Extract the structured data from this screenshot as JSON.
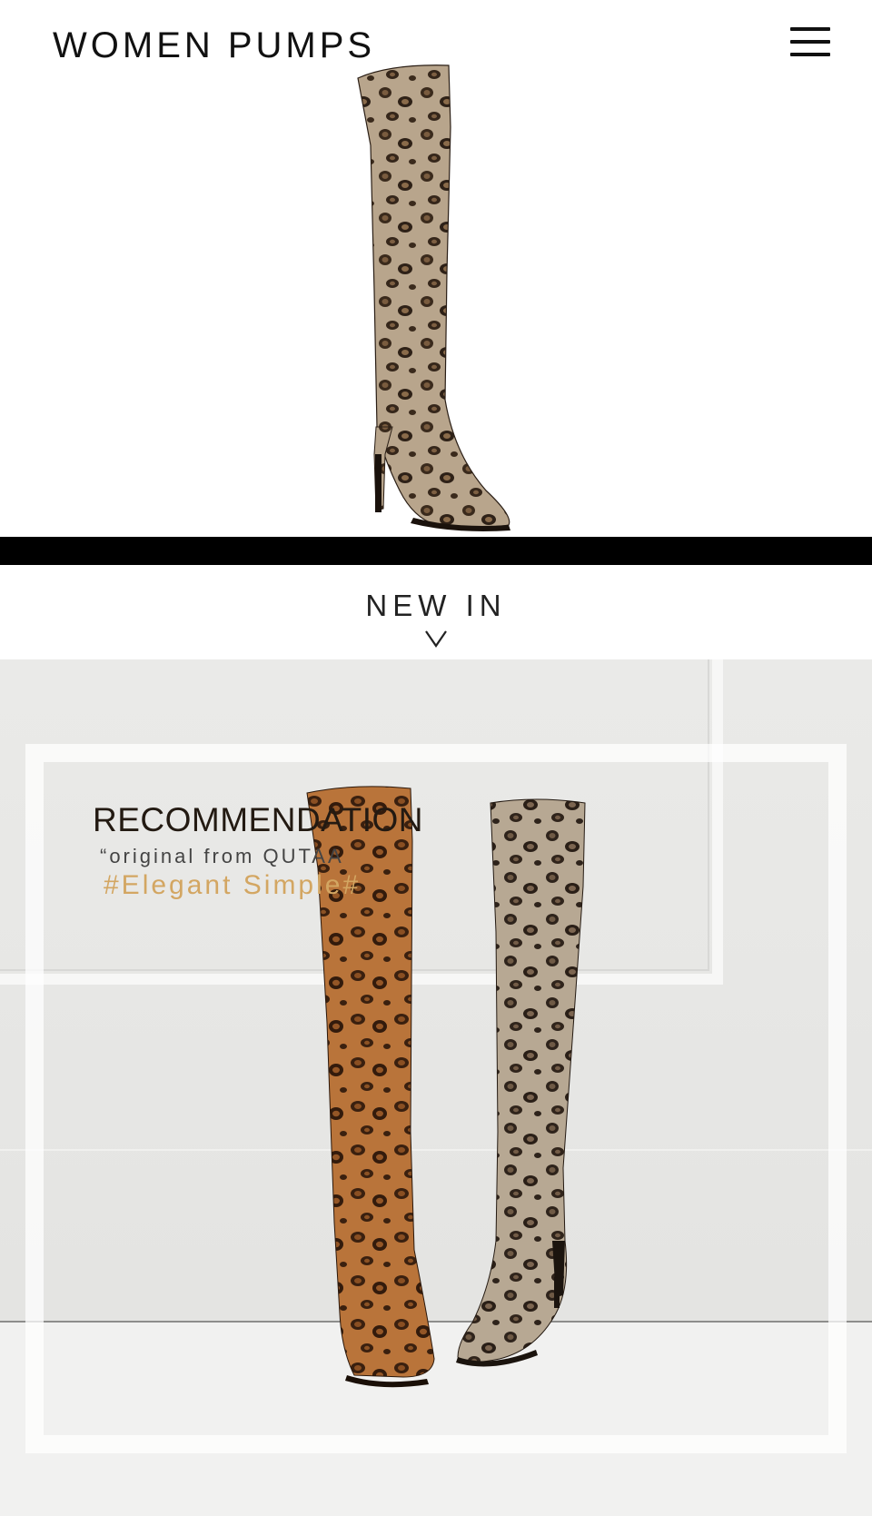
{
  "header": {
    "brand_title": "WOMEN PUMPS",
    "menu_icon": "hamburger-menu-icon"
  },
  "hero": {
    "image": "leopard-print-over-the-knee-boot"
  },
  "new_in": {
    "label": "NEW IN",
    "chevron_icon": "chevron-down-icon"
  },
  "promo": {
    "title": "RECOMMENDATION",
    "subtitle": "“original from QUTAA",
    "tagline": "#Elegant Simple#",
    "colors": {
      "tagline": "#d3a662",
      "title": "#231a12",
      "background": "#e9e9e7"
    }
  }
}
